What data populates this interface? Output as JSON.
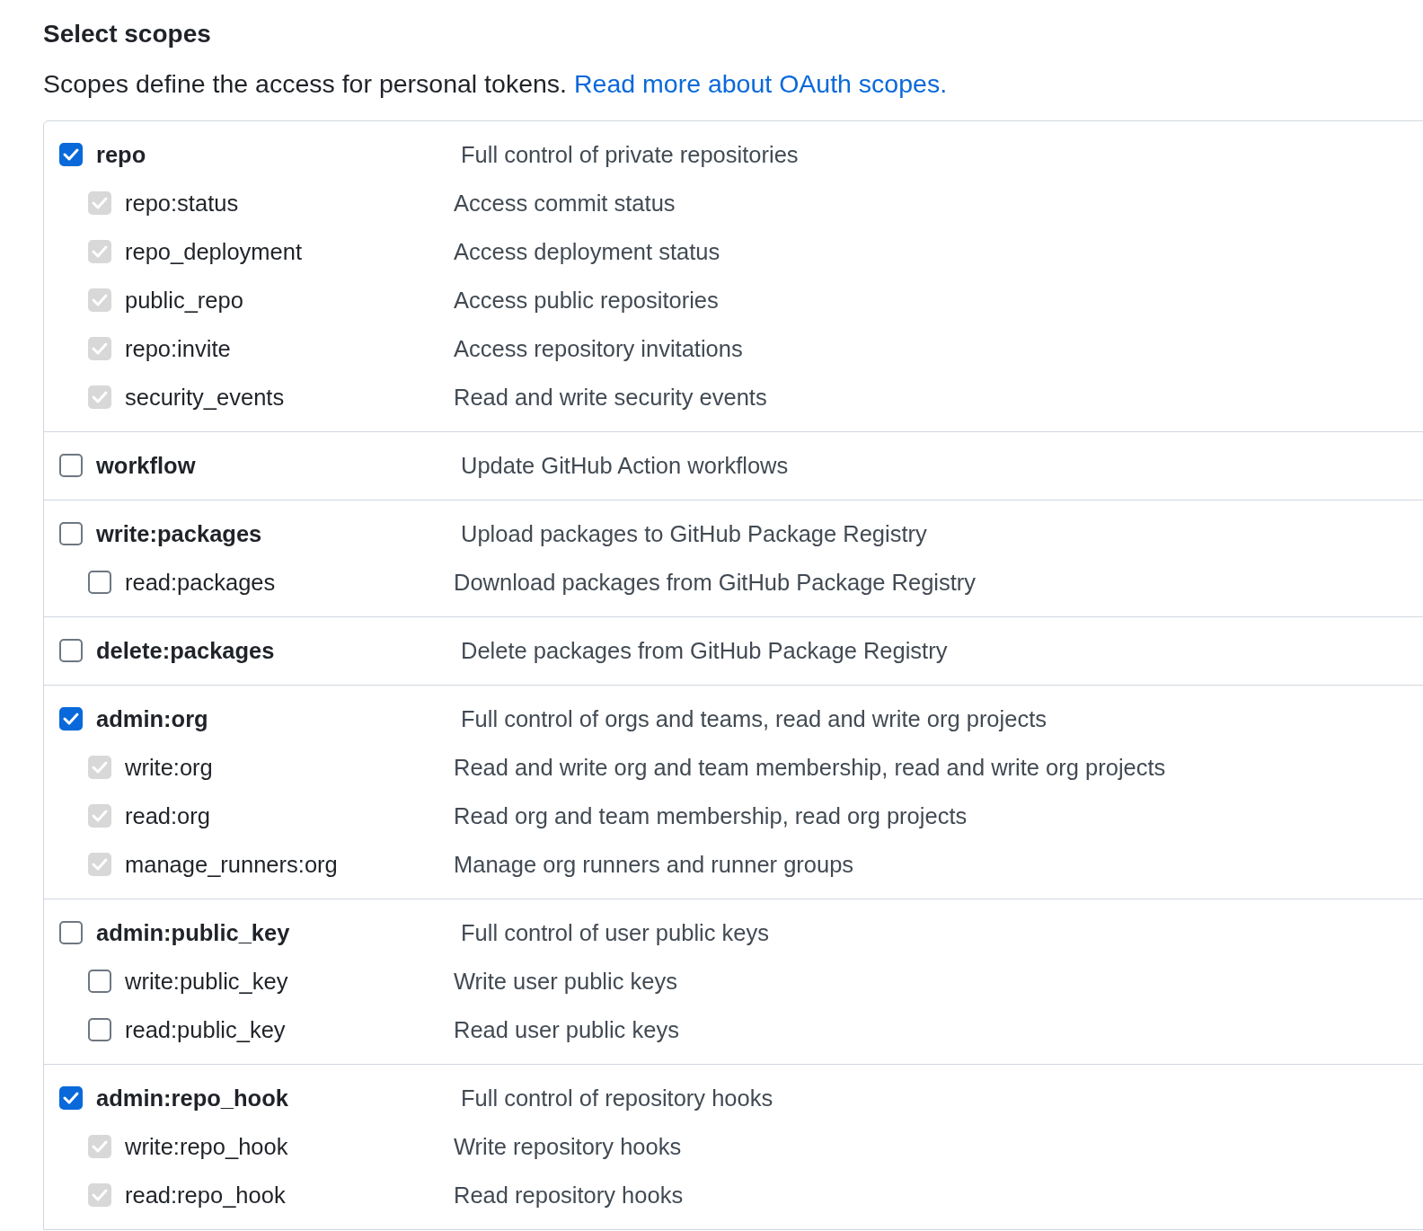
{
  "heading": "Select scopes",
  "intro": {
    "text": "Scopes define the access for personal tokens.",
    "link": "Read more about OAuth scopes."
  },
  "groups": [
    {
      "name": "repo",
      "description": "Full control of private repositories",
      "checked": true,
      "children": [
        {
          "name": "repo:status",
          "description": "Access commit status",
          "checked": true,
          "disabled": true
        },
        {
          "name": "repo_deployment",
          "description": "Access deployment status",
          "checked": true,
          "disabled": true
        },
        {
          "name": "public_repo",
          "description": "Access public repositories",
          "checked": true,
          "disabled": true
        },
        {
          "name": "repo:invite",
          "description": "Access repository invitations",
          "checked": true,
          "disabled": true
        },
        {
          "name": "security_events",
          "description": "Read and write security events",
          "checked": true,
          "disabled": true
        }
      ]
    },
    {
      "name": "workflow",
      "description": "Update GitHub Action workflows",
      "checked": false
    },
    {
      "name": "write:packages",
      "description": "Upload packages to GitHub Package Registry",
      "checked": false,
      "children": [
        {
          "name": "read:packages",
          "description": "Download packages from GitHub Package Registry",
          "checked": false,
          "disabled": false
        }
      ]
    },
    {
      "name": "delete:packages",
      "description": "Delete packages from GitHub Package Registry",
      "checked": false
    },
    {
      "name": "admin:org",
      "description": "Full control of orgs and teams, read and write org projects",
      "checked": true,
      "children": [
        {
          "name": "write:org",
          "description": "Read and write org and team membership, read and write org projects",
          "checked": true,
          "disabled": true
        },
        {
          "name": "read:org",
          "description": "Read org and team membership, read org projects",
          "checked": true,
          "disabled": true
        },
        {
          "name": "manage_runners:org",
          "description": "Manage org runners and runner groups",
          "checked": true,
          "disabled": true
        }
      ]
    },
    {
      "name": "admin:public_key",
      "description": "Full control of user public keys",
      "checked": false,
      "children": [
        {
          "name": "write:public_key",
          "description": "Write user public keys",
          "checked": false,
          "disabled": false
        },
        {
          "name": "read:public_key",
          "description": "Read user public keys",
          "checked": false,
          "disabled": false
        }
      ]
    },
    {
      "name": "admin:repo_hook",
      "description": "Full control of repository hooks",
      "checked": true,
      "children": [
        {
          "name": "write:repo_hook",
          "description": "Write repository hooks",
          "checked": true,
          "disabled": true
        },
        {
          "name": "read:repo_hook",
          "description": "Read repository hooks",
          "checked": true,
          "disabled": true
        }
      ]
    }
  ]
}
